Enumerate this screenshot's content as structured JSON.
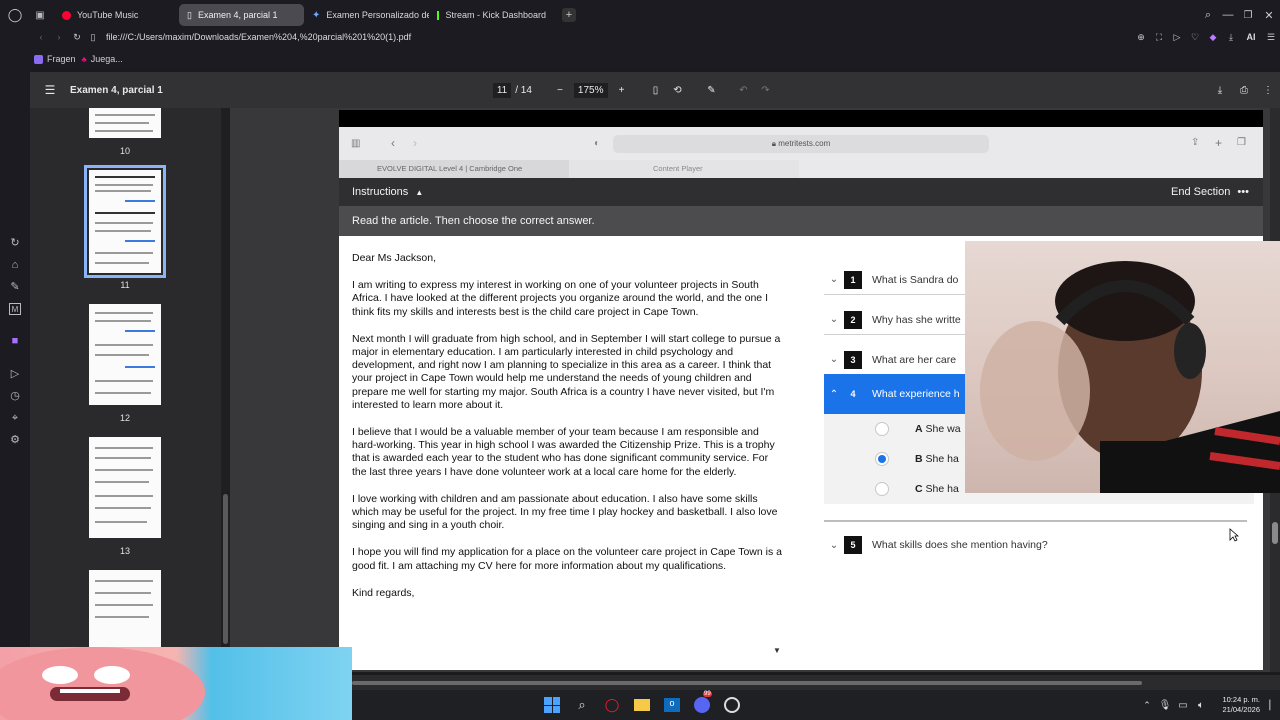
{
  "browser": {
    "tabs": [
      {
        "label": "YouTube Music",
        "icon": "youtube-music-icon",
        "active": false
      },
      {
        "label": "Examen 4, parcial 1",
        "icon": "document-icon",
        "active": true
      },
      {
        "label": "Examen Personalizado de",
        "icon": "gemini-icon",
        "active": false
      },
      {
        "label": "Stream - Kick Dashboard",
        "icon": "kick-icon",
        "active": false
      }
    ],
    "url": "file:///C:/Users/maxim/Downloads/Examen%204,%20parcial%201%20(1).pdf",
    "bookmarks": [
      "Fragen",
      "Juega..."
    ],
    "ai_label": "AI"
  },
  "pdf": {
    "title": "Examen 4, parcial 1",
    "page_current": "11",
    "page_total": "/ 14",
    "zoom": "175%",
    "thumbs": [
      {
        "num": "10"
      },
      {
        "num": "11"
      },
      {
        "num": "12"
      },
      {
        "num": "13"
      }
    ]
  },
  "test": {
    "address": "metritests.com",
    "safari_tab_1": "EVOLVE DIGITAL Level 4 | Cambridge One",
    "safari_tab_2": "Content Player",
    "instructions_label": "Instructions",
    "end_section": "End Section",
    "read_prompt": "Read the article. Then choose the correct answer.",
    "greeting": "Dear Ms Jackson,",
    "paragraphs": [
      "I am writing to express my interest in working on one of your volunteer projects in South Africa. I have looked at the different projects you organize around the world, and the one I think fits my skills and interests best is the child care project in Cape Town.",
      "Next month I will graduate from high school, and in September I will start college to pursue a major in elementary education. I am particularly interested in child psychology and development, and right now I am planning to specialize in this area as a career. I think that your project in Cape Town would help me understand the needs of young children and prepare me well for starting my major. South Africa is a country I have never visited, but I'm interested to learn more about it.",
      "I believe that I would be a valuable member of your team because I am responsible and hard-working. This year in high school I was awarded the Citizenship Prize. This is a trophy that is awarded each year to the student who has done significant community service. For the last three years I have done volunteer work at a local care home for the elderly.",
      "I love working with children and am passionate about education. I also have some skills which may be useful for the project. In my free time I play hockey and basketball. I also love singing and sing in a youth choir.",
      "I hope you will find my application for a place on the volunteer care project in Cape Town is a good fit. I am attaching my CV here for more information about my qualifications."
    ],
    "closing": "Kind regards,",
    "questions": [
      {
        "num": "1",
        "text": "What is Sandra do"
      },
      {
        "num": "2",
        "text": "Why has she writte"
      },
      {
        "num": "3",
        "text": "What are her care"
      },
      {
        "num": "4",
        "text": "What experience h"
      },
      {
        "num": "5",
        "text": "What skills does she mention having?"
      }
    ],
    "options": [
      {
        "letter": "A",
        "text": "She wa"
      },
      {
        "letter": "B",
        "text": "She ha"
      },
      {
        "letter": "C",
        "text": "She ha"
      }
    ],
    "selected_option": "B"
  },
  "taskbar": {
    "time": "10:24 p. m.",
    "date": "21/04/2026",
    "badge": "99"
  },
  "colors": {
    "accent": "#1a73e8",
    "active_question": "#1a73e8",
    "thumb_selected": "#8ab4f8"
  }
}
